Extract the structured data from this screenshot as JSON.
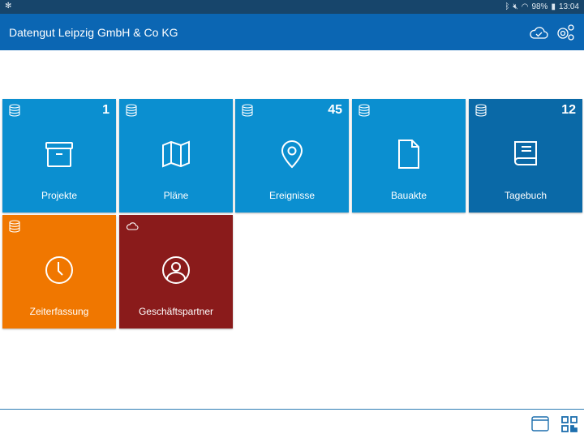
{
  "status_bar": {
    "battery": "98%",
    "time": "13:04"
  },
  "header": {
    "title": "Datengut Leipzig GmbH & Co KG"
  },
  "tiles": [
    {
      "label": "Projekte",
      "count": "1",
      "color": "#0b8fd0",
      "source": "database-icon",
      "icon": "archive-box-icon"
    },
    {
      "label": "Pläne",
      "count": "",
      "color": "#0b8fd0",
      "source": "database-icon",
      "icon": "map-icon"
    },
    {
      "label": "Ereignisse",
      "count": "45",
      "color": "#0b8fd0",
      "source": "database-icon",
      "icon": "location-pin-icon"
    },
    {
      "label": "Bauakte",
      "count": "",
      "color": "#0b8fd0",
      "source": "database-icon",
      "icon": "document-icon"
    },
    {
      "label": "Tagebuch",
      "count": "12",
      "color": "#0a69a7",
      "source": "database-icon",
      "icon": "book-icon"
    },
    {
      "label": "Zeiterfassung",
      "count": "",
      "color": "#f07700",
      "source": "database-icon",
      "icon": "clock-icon"
    },
    {
      "label": "Geschäftspartner",
      "count": "",
      "color": "#8a1b1b",
      "source": "cloud-icon",
      "icon": "user-circle-icon"
    }
  ]
}
